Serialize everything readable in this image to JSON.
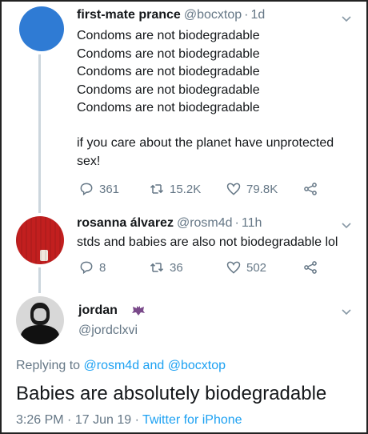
{
  "tweet1": {
    "display_name": "first-mate prance",
    "handle": "@bocxtop",
    "separator": "·",
    "time": "1d",
    "lines": [
      "Condoms are not biodegradable",
      "Condoms are not biodegradable",
      "Condoms are not biodegradable",
      "Condoms are not biodegradable",
      "Condoms are not biodegradable"
    ],
    "closing_line_1": "if you care about the planet have unprotected",
    "closing_line_2": "sex!",
    "replies": "361",
    "retweets": "15.2K",
    "likes": "79.8K",
    "avatar_color": "#2f7bd4"
  },
  "tweet2": {
    "display_name": "rosanna álvarez",
    "handle": "@rosm4d",
    "separator": "·",
    "time": "11h",
    "text": "stds and babies are also not biodegradable lol",
    "replies": "8",
    "retweets": "36",
    "likes": "502",
    "avatar_color": "#c21f1f"
  },
  "main_tweet": {
    "display_name": "jordan",
    "handle": "@jordclxvi",
    "replying_prefix": "Replying to",
    "reply_user_1": "@rosm4d",
    "reply_and": "and",
    "reply_user_2": "@bocxtop",
    "text": "Babies are absolutely biodegradable",
    "time": "3:26 PM",
    "separator": "·",
    "date": "17 Jun 19",
    "source": "Twitter for iPhone"
  },
  "colors": {
    "link": "#1da1f2",
    "secondary": "#657786",
    "thread_line": "#ccd6dd"
  }
}
